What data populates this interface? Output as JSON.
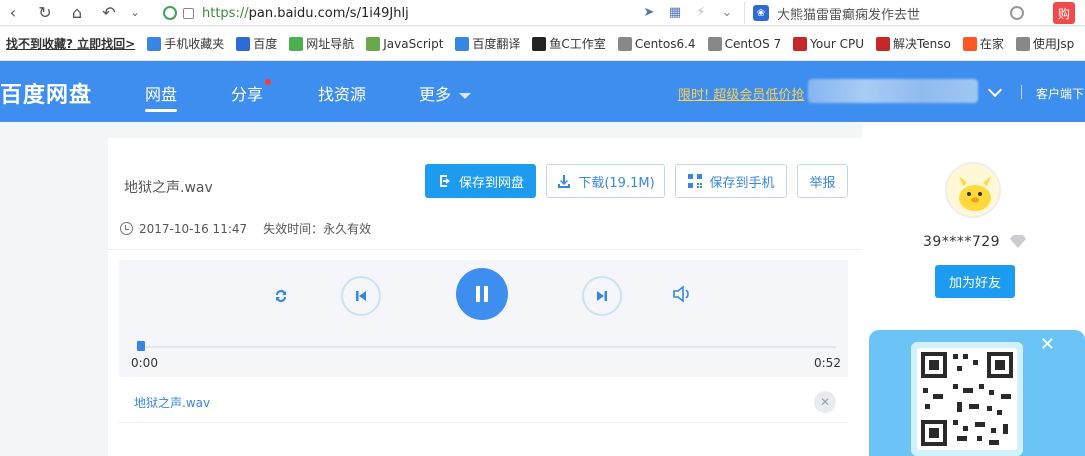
{
  "browser": {
    "url_scheme": "https://",
    "url_host": "pan.baidu.com",
    "url_path": "/s/1i49Jhlj",
    "search_text": "大熊猫雷雷癫痫发作去世",
    "shop_label": "购"
  },
  "bookmarks": [
    {
      "label": "找不到收藏? 立即找回>",
      "icon": "",
      "color": ""
    },
    {
      "label": "手机收藏夹",
      "icon": "phone-icon",
      "color": "#3886e4"
    },
    {
      "label": "百度",
      "icon": "baidu-paw-icon",
      "color": "#2e6bd6"
    },
    {
      "label": "网址导航",
      "icon": "hao-icon",
      "color": "#4caf50"
    },
    {
      "label": "JavaScript",
      "icon": "js-icon",
      "color": "#6aa84f"
    },
    {
      "label": "百度翻译",
      "icon": "translate-icon",
      "color": "#3886e4"
    },
    {
      "label": "鱼C工作室",
      "icon": "fc-icon",
      "color": "#222222"
    },
    {
      "label": "Centos6.4",
      "icon": "centos-icon",
      "color": "#888888"
    },
    {
      "label": "CentOS 7",
      "icon": "centos-icon",
      "color": "#888888"
    },
    {
      "label": "Your CPU",
      "icon": "c-icon",
      "color": "#c62828"
    },
    {
      "label": "解决Tenso",
      "icon": "c-icon",
      "color": "#c62828"
    },
    {
      "label": "在家",
      "icon": "zaijia-icon",
      "color": "#ff5722"
    },
    {
      "label": "使用Jsp",
      "icon": "centos-icon",
      "color": "#888888"
    }
  ],
  "topnav": {
    "logo": "百度网盘",
    "tabs": [
      "网盘",
      "分享",
      "找资源",
      "更多"
    ],
    "promo": "限时! 超级会员低价抢",
    "client_download": "客户端下"
  },
  "file": {
    "name": "地狱之声.wav",
    "save_label": "保存到网盘",
    "download_label": "下载(19.1M)",
    "save_phone_label": "保存到手机",
    "report_label": "举报",
    "date": "2017-10-16 11:47",
    "expiry_label": "失效时间：永久有效"
  },
  "player": {
    "current_time": "0:00",
    "total_time": "0:52",
    "progress": 0.0,
    "track_name": "地狱之声.wav"
  },
  "sidebar": {
    "username": "39****729",
    "add_friend_label": "加为好友"
  },
  "colors": {
    "brand_blue": "#3e8eef",
    "button_blue": "#1d9bf0",
    "promo_yellow": "#ffd14f"
  }
}
